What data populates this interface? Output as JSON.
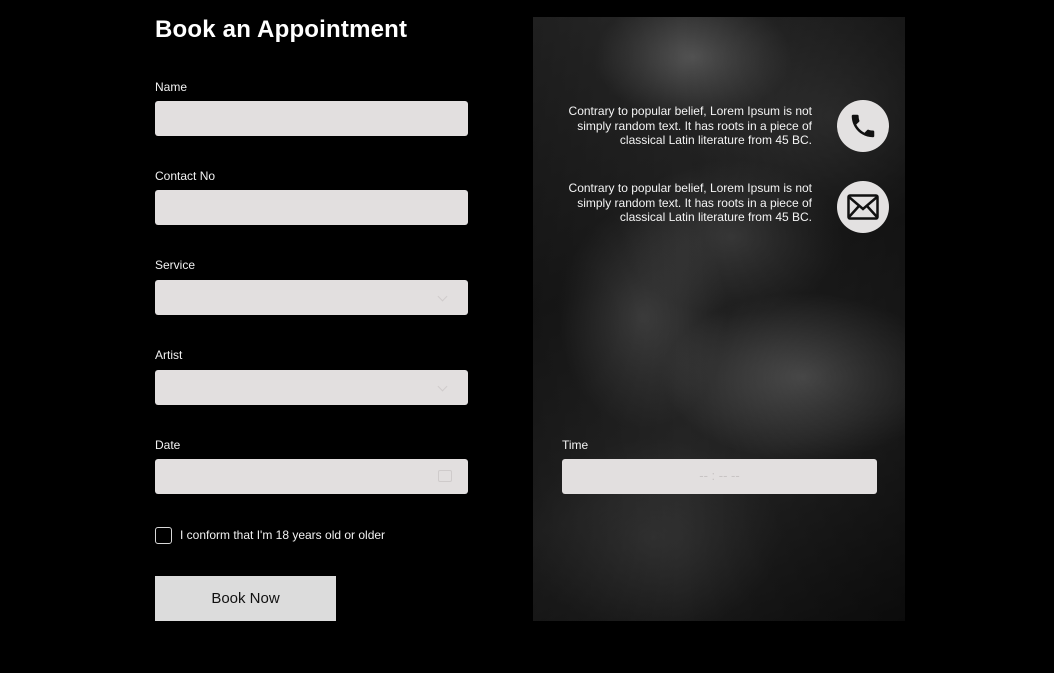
{
  "form": {
    "title": "Book an Appointment",
    "fields": {
      "name": {
        "label": "Name",
        "value": "",
        "placeholder": ""
      },
      "contact": {
        "label": "Contact No",
        "value": "",
        "placeholder": ""
      },
      "service": {
        "label": "Service",
        "value": ""
      },
      "artist": {
        "label": "Artist",
        "value": ""
      },
      "date": {
        "label": "Date",
        "value": ""
      },
      "time": {
        "label": "Time",
        "value": "-- : -- --"
      }
    },
    "age_checkbox": {
      "label": "I conform that I'm 18 years old or older",
      "checked": false
    },
    "submit_label": "Book Now"
  },
  "contact_info": [
    {
      "icon": "phone-icon",
      "lines": [
        "Contrary to popular belief, Lorem Ipsum is not",
        "simply random text. It has roots in a piece of",
        "classical Latin literature from 45 BC."
      ]
    },
    {
      "icon": "envelope-icon",
      "lines": [
        "Contrary to popular belief, Lorem Ipsum is not",
        "simply random text. It has roots in a piece of",
        "classical Latin literature from 45 BC."
      ]
    }
  ],
  "colors": {
    "background": "#000000",
    "field_bg": "#e2dfdf",
    "button_bg": "#dcdcdc",
    "text": "#ffffff"
  }
}
